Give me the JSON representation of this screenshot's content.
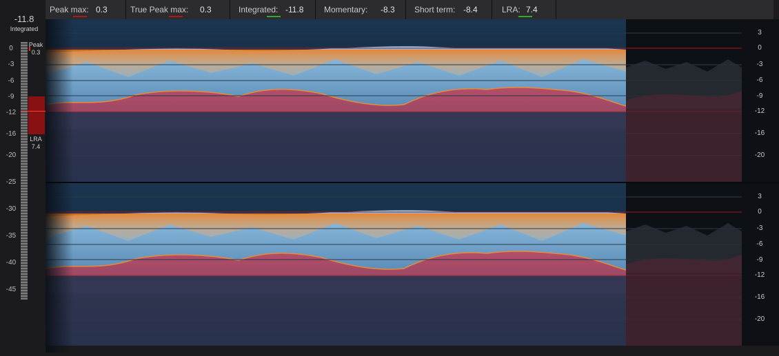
{
  "stats": [
    {
      "label": "Peak max:",
      "value": "0.3",
      "indicator": "#b01818"
    },
    {
      "label": "True Peak max:",
      "value": "0.3",
      "indicator": "#b01818"
    },
    {
      "label": "Integrated:",
      "value": "-11.8",
      "indicator": "#2ea82e"
    },
    {
      "label": "Momentary:",
      "value": "-8.3",
      "indicator": ""
    },
    {
      "label": "Short term:",
      "value": "-8.4",
      "indicator": ""
    },
    {
      "label": "LRA:",
      "value": "7.4",
      "indicator": "#2ea82e"
    }
  ],
  "integrated": {
    "value": "-11.8",
    "label": "Integrated"
  },
  "meter": {
    "peak_label": "Peak",
    "peak_value": "0.3",
    "lra_label": "LRA",
    "lra_value": "7.4",
    "scale": [
      "0",
      "-3",
      "-6",
      "-9",
      "-12",
      "-16",
      "-20",
      "-25",
      "-30",
      "-35",
      "-40",
      "-45"
    ]
  },
  "graph_scale": [
    "3",
    "0",
    "-3",
    "-6",
    "-9",
    "-12",
    "-16",
    "-20"
  ],
  "colors": {
    "peak": "#f08a24",
    "ok": "#2ea82e",
    "limit": "#c0141c",
    "loudness": "#b44050",
    "body": "#6fa0cc"
  }
}
